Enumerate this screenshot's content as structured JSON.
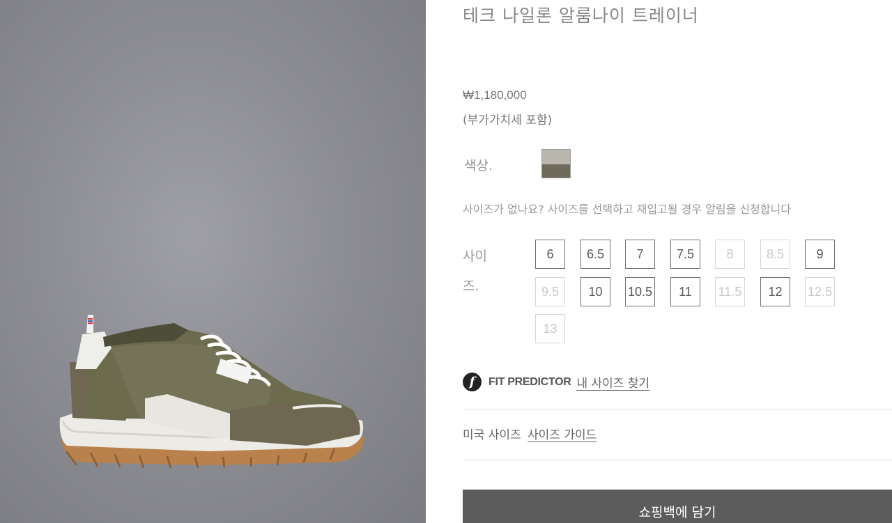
{
  "product": {
    "title": "테크 나일론 알룸나이 트레이너",
    "price": "₩1,180,000",
    "vat_note": "(부가가치세 포함)",
    "image_icon": "sneaker-product-image"
  },
  "color": {
    "label": "색상.",
    "swatch_colors": {
      "top": "#b9b6ad",
      "bottom": "#706a5c"
    }
  },
  "size": {
    "notify_text": "사이즈가 없나요? 사이즈를 선택하고 재입고될 경우 알림을 신청합니다",
    "label": "사이즈.",
    "options": [
      {
        "label": "6",
        "available": true
      },
      {
        "label": "6.5",
        "available": true
      },
      {
        "label": "7",
        "available": true
      },
      {
        "label": "7.5",
        "available": true
      },
      {
        "label": "8",
        "available": false
      },
      {
        "label": "8.5",
        "available": false
      },
      {
        "label": "9",
        "available": true
      },
      {
        "label": "9.5",
        "available": false
      },
      {
        "label": "10",
        "available": true
      },
      {
        "label": "10.5",
        "available": true
      },
      {
        "label": "11",
        "available": true
      },
      {
        "label": "11.5",
        "available": false
      },
      {
        "label": "12",
        "available": true
      },
      {
        "label": "12.5",
        "available": false
      },
      {
        "label": "13",
        "available": false
      }
    ]
  },
  "fit_predictor": {
    "icon_letter": "f",
    "brand": "FIT PREDICTOR",
    "link": "내 사이즈 찾기"
  },
  "us_size": {
    "label": "미국 사이즈",
    "guide_link": "사이즈 가이드"
  },
  "cta": {
    "add_to_bag": "쇼핑백에 담기"
  }
}
